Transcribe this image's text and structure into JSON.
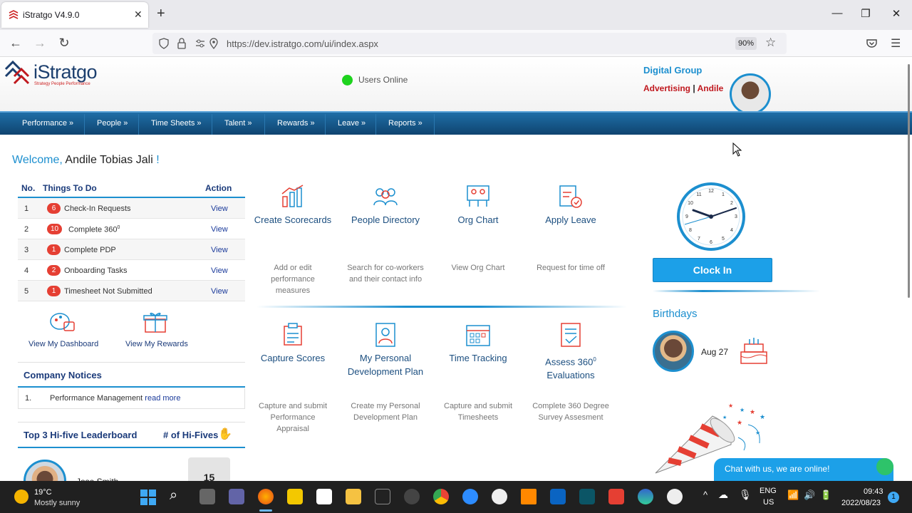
{
  "browser": {
    "tab_title": "iStratgo V4.9.0",
    "url": "https://dev.istratgo.com/ui/index.aspx",
    "zoom": "90%"
  },
  "header": {
    "logo_text": "iStratgo",
    "logo_tagline": "Strategy People Performance",
    "online_label": "Users Online",
    "company": "Digital Group",
    "department": "Advertising",
    "separator": "|",
    "user_short": "Andile"
  },
  "menu": [
    "Performance »",
    "People »",
    "Time Sheets »",
    "Talent »",
    "Rewards »",
    "Leave »",
    "Reports »"
  ],
  "welcome": {
    "prefix": "Welcome,",
    "name": "Andile Tobias Jali",
    "suffix": "!"
  },
  "todo": {
    "col_no": "No.",
    "col_task": "Things To Do",
    "col_action": "Action",
    "rows": [
      {
        "no": "1",
        "count": "6",
        "label": "Check-In Requests",
        "action": "View"
      },
      {
        "no": "2",
        "count": "10",
        "label": "Complete 360",
        "sup": "0",
        "action": "View"
      },
      {
        "no": "3",
        "count": "1",
        "label": "Complete PDP",
        "action": "View"
      },
      {
        "no": "4",
        "count": "2",
        "label": "Onboarding Tasks",
        "action": "View"
      },
      {
        "no": "5",
        "count": "1",
        "label": "Timesheet Not Submitted",
        "action": "View"
      }
    ]
  },
  "quick_links": {
    "dashboard": "View My Dashboard",
    "rewards": "View My Rewards"
  },
  "notices": {
    "title": "Company Notices",
    "items": [
      {
        "no": "1.",
        "text": "Performance Management",
        "link": "read more"
      }
    ]
  },
  "leaderboard": {
    "title": "Top 3 Hi-five Leaderboard",
    "col": "# of Hi-Fives",
    "name": "Jose Smith",
    "count": "15"
  },
  "tiles": [
    {
      "title": "Create Scorecards",
      "desc": "Add or edit performance measures"
    },
    {
      "title": "People Directory",
      "desc": "Search for co-workers and their contact info"
    },
    {
      "title": "Org Chart",
      "desc": "View Org Chart"
    },
    {
      "title": "Apply Leave",
      "desc": "Request for time off"
    },
    {
      "title": "Capture Scores",
      "desc": "Capture and submit Performance Appraisal"
    },
    {
      "title": "My Personal Development Plan",
      "desc": "Create my Personal Development Plan"
    },
    {
      "title": "Time Tracking",
      "desc": "Capture and submit Timesheets"
    },
    {
      "title": "Assess 360",
      "title_sup": "0",
      "title_line2": "Evaluations",
      "desc": "Complete 360 Degree Survey Assesment"
    }
  ],
  "clock": {
    "button": "Clock In"
  },
  "birthdays": {
    "title": "Birthdays",
    "date": "Aug 27"
  },
  "chat": {
    "label": "Chat with us, we are online!"
  },
  "taskbar": {
    "temp": "19°C",
    "weather": "Mostly sunny",
    "lang1": "ENG",
    "lang2": "US",
    "time": "09:43",
    "date": "2022/08/23",
    "notif": "1"
  },
  "colors": {
    "accent": "#1c8fcf",
    "menu": "#0f4470",
    "badge": "#e53f33",
    "brand_red": "#c0181e"
  }
}
